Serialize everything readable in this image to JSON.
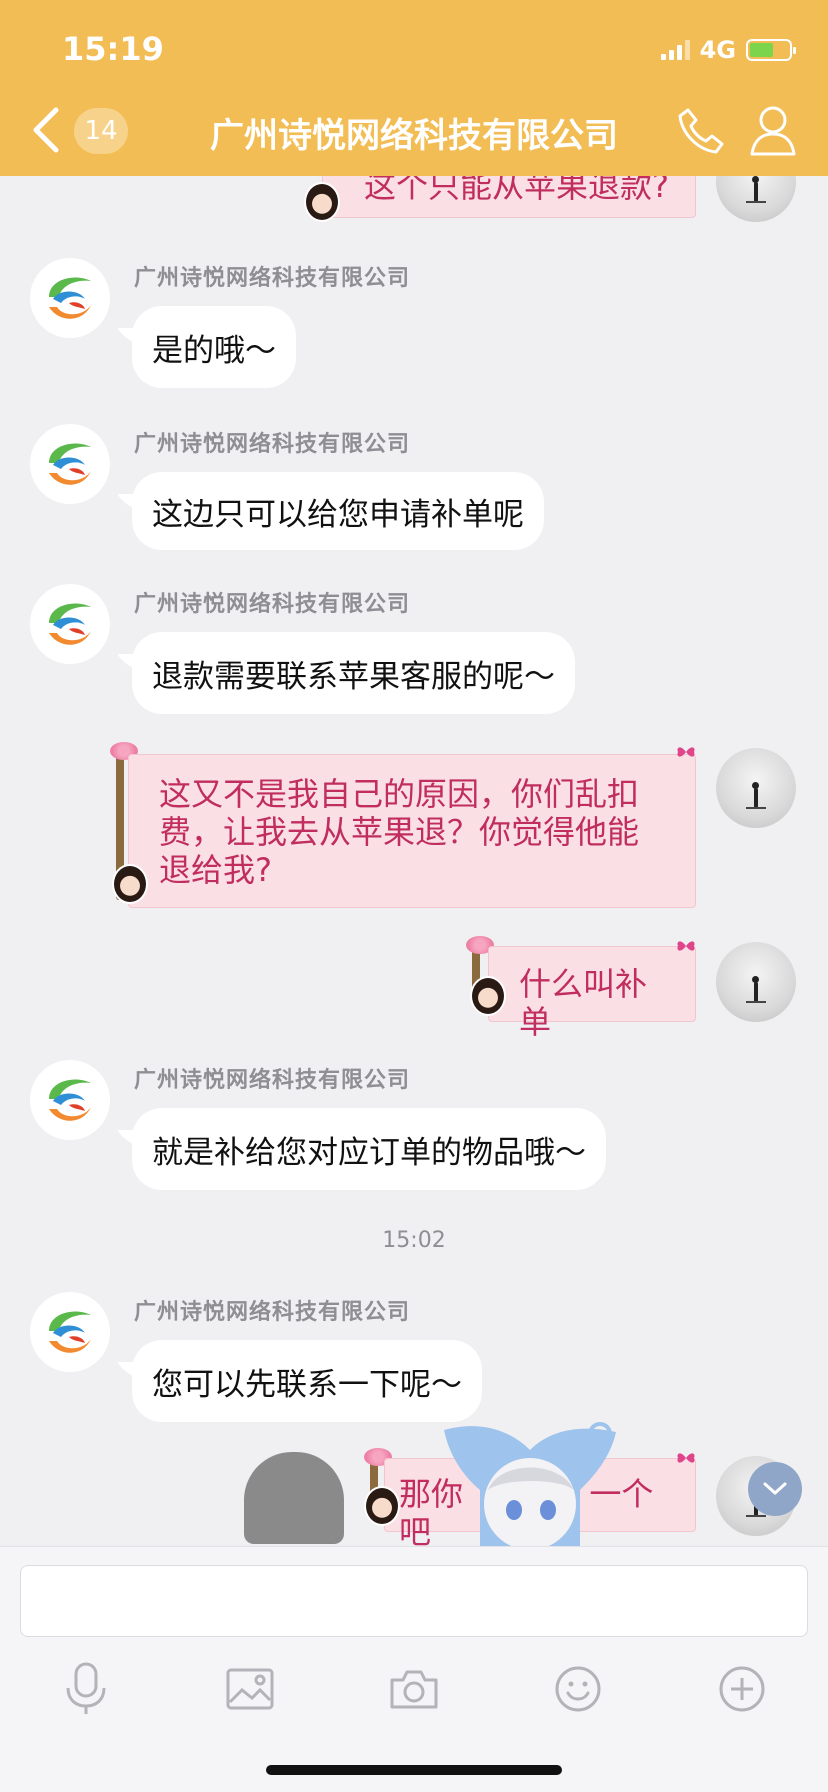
{
  "status": {
    "time": "15:19",
    "network": "4G"
  },
  "header": {
    "back_badge": "14",
    "title": "广州诗悦网络科技有限公司"
  },
  "messages": {
    "m0": {
      "text": "这个只能从苹果退款?"
    },
    "m1": {
      "sender": "广州诗悦网络科技有限公司",
      "text": "是的哦～"
    },
    "m2": {
      "sender": "广州诗悦网络科技有限公司",
      "text": "这边只可以给您申请补单呢"
    },
    "m3": {
      "sender": "广州诗悦网络科技有限公司",
      "text": "退款需要联系苹果客服的呢～"
    },
    "m4": {
      "line1": "这又不是我自己的原因，你们乱扣",
      "line2": "费，让我去从苹果退？你觉得他能",
      "line3": "退给我?"
    },
    "m5": {
      "text": "什么叫补单"
    },
    "m6": {
      "sender": "广州诗悦网络科技有限公司",
      "text": "就是补给您对应订单的物品哦～"
    },
    "time_divider": "15:02",
    "m7": {
      "sender": "广州诗悦网络科技有限公司",
      "text": "您可以先联系一下呢～"
    },
    "m8": {
      "text_a": "那你",
      "text_b": "一个吧"
    }
  },
  "icons": {
    "header": [
      "back-arrow-icon",
      "phone-icon",
      "person-icon"
    ],
    "toolbar": [
      "microphone-icon",
      "image-icon",
      "camera-icon",
      "emoji-icon",
      "plus-icon"
    ]
  },
  "colors": {
    "header_bg": "#f3bd56",
    "outgoing_bubble": "#fae0e5",
    "outgoing_text": "#c02d5e",
    "incoming_bubble": "#ffffff"
  }
}
